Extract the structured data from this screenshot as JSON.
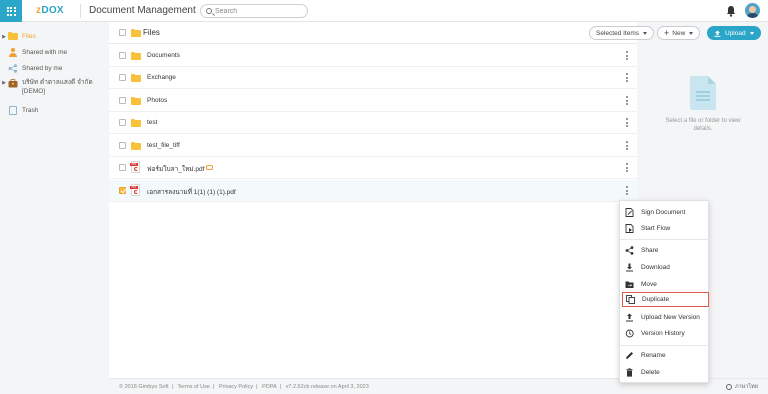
{
  "header": {
    "logo_prefix": "z",
    "logo_main": "DOX",
    "app_title": "Document Management",
    "search_placeholder": "Search"
  },
  "sidebar": {
    "items": [
      {
        "label": "Files",
        "icon": "folder-icon",
        "active": true
      },
      {
        "label": "Shared with me",
        "icon": "person-icon"
      },
      {
        "label": "Shared by me",
        "icon": "share-icon"
      },
      {
        "label": "บริษัท ดำตาลแสงดี จำกัด",
        "label2": "[DEMO]",
        "icon": "briefcase-icon"
      },
      {
        "label": "Trash",
        "icon": "trash-icon"
      }
    ]
  },
  "toolbar": {
    "title": "Files",
    "selected_items": "Selected Items",
    "new_label": "New",
    "upload_label": "Upload"
  },
  "files": [
    {
      "name": "Documents",
      "type": "folder"
    },
    {
      "name": "Exchange",
      "type": "folder"
    },
    {
      "name": "Photos",
      "type": "folder"
    },
    {
      "name": "test",
      "type": "folder"
    },
    {
      "name": "test_file_tiff",
      "type": "folder"
    },
    {
      "name": "ฟอร์มใบลา_ใหม่.pdf",
      "type": "pdf",
      "shared": true
    },
    {
      "name": "เอกสารลงนามที่ 1(1) (1) (1).pdf",
      "type": "pdf",
      "selected": true
    }
  ],
  "details": {
    "hint": "Select a file or folder to view details."
  },
  "context_menu": {
    "items": [
      {
        "label": "Sign Document",
        "icon": "sign-document-icon"
      },
      {
        "label": "Start Flow",
        "icon": "start-flow-icon"
      },
      {
        "label": "Share",
        "icon": "share-icon"
      },
      {
        "label": "Download",
        "icon": "download-icon"
      },
      {
        "label": "Move",
        "icon": "move-folder-icon"
      },
      {
        "label": "Duplicate",
        "icon": "duplicate-icon",
        "highlighted": true
      },
      {
        "label": "Upload New Version",
        "icon": "upload-icon"
      },
      {
        "label": "Version History",
        "icon": "history-icon"
      },
      {
        "label": "Rename",
        "icon": "pencil-icon"
      },
      {
        "label": "Delete",
        "icon": "trash-icon"
      }
    ]
  },
  "footer": {
    "copyright": "© 2018 Gimbyo Soft",
    "terms": "Terms of Use",
    "privacy": "Privacy Policy",
    "pdpa": "PDPA",
    "version": "v7.2.52cb release on April 3, 2023",
    "language": "ภาษาไทย"
  },
  "colors": {
    "accent": "#2ba5c8",
    "folder": "#f7c23a",
    "active_nav": "#f0a030",
    "highlight_border": "#e45a4f"
  }
}
